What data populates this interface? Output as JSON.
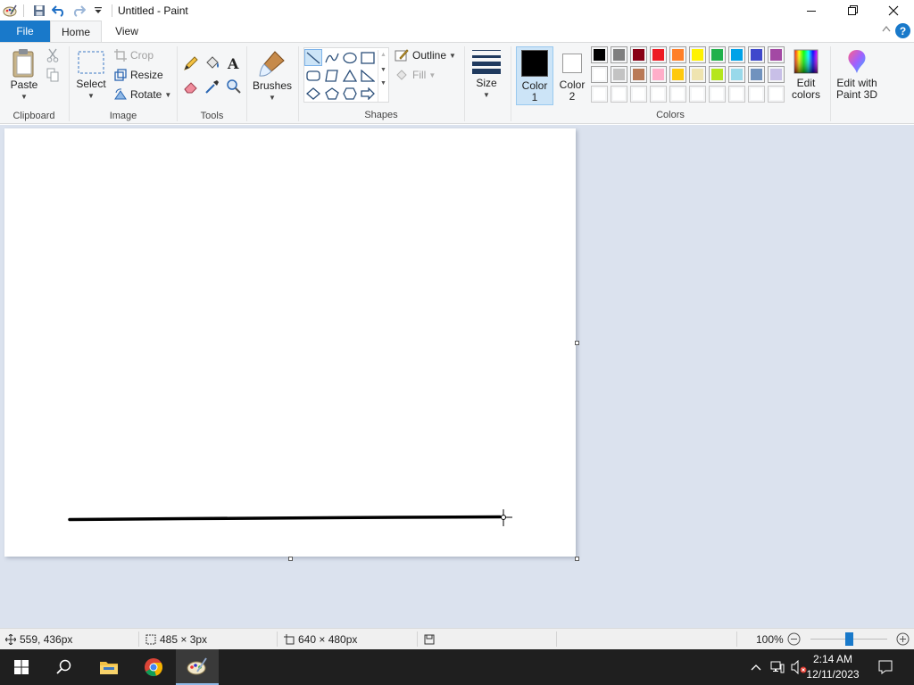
{
  "window": {
    "title": "Untitled - Paint"
  },
  "tabs": {
    "file": "File",
    "home": "Home",
    "view": "View"
  },
  "clipboard": {
    "paste": "Paste",
    "group_label": "Clipboard"
  },
  "image": {
    "select": "Select",
    "crop": "Crop",
    "resize": "Resize",
    "rotate": "Rotate",
    "group_label": "Image"
  },
  "tools": {
    "group_label": "Tools"
  },
  "brushes": {
    "label": "Brushes"
  },
  "shapes": {
    "outline": "Outline",
    "fill": "Fill",
    "group_label": "Shapes"
  },
  "size": {
    "label": "Size"
  },
  "colors": {
    "color1_label_a": "Color",
    "color1_label_b": "1",
    "color2_label_a": "Color",
    "color2_label_b": "2",
    "color1_value": "#000000",
    "color2_value": "#ffffff",
    "edit_label_a": "Edit",
    "edit_label_b": "colors",
    "paint3d_label_a": "Edit with",
    "paint3d_label_b": "Paint 3D",
    "group_label": "Colors",
    "palette_row1": [
      "#000000",
      "#7f7f7f",
      "#880015",
      "#ed1c24",
      "#ff7f27",
      "#fff200",
      "#22b14c",
      "#00a2e8",
      "#3f48cc",
      "#a349a4"
    ],
    "palette_row2": [
      "#ffffff",
      "#c3c3c3",
      "#b97a57",
      "#ffaec9",
      "#ffc90e",
      "#efe4b0",
      "#b5e61d",
      "#99d9ea",
      "#7092be",
      "#c8bfe7"
    ],
    "palette_row3": [
      "#ffffff",
      "#ffffff",
      "#ffffff",
      "#ffffff",
      "#ffffff",
      "#ffffff",
      "#ffffff",
      "#ffffff",
      "#ffffff",
      "#ffffff"
    ]
  },
  "status": {
    "cursor_pos": "559, 436px",
    "selection_size": "485 × 3px",
    "canvas_size": "640 × 480px",
    "zoom": "100%",
    "zoom_percent": 100
  },
  "taskbar": {
    "time": "2:14 AM",
    "date": "12/11/2023"
  }
}
